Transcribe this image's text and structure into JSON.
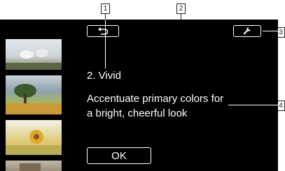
{
  "callouts": [
    "1",
    "2",
    "3",
    "4"
  ],
  "title": "2. Vivid",
  "description": "Accentuate primary colors for a bright, cheerful look",
  "ok_label": "OK",
  "icons": {
    "back": "return-arrow-icon",
    "settings": "wrench-icon"
  }
}
